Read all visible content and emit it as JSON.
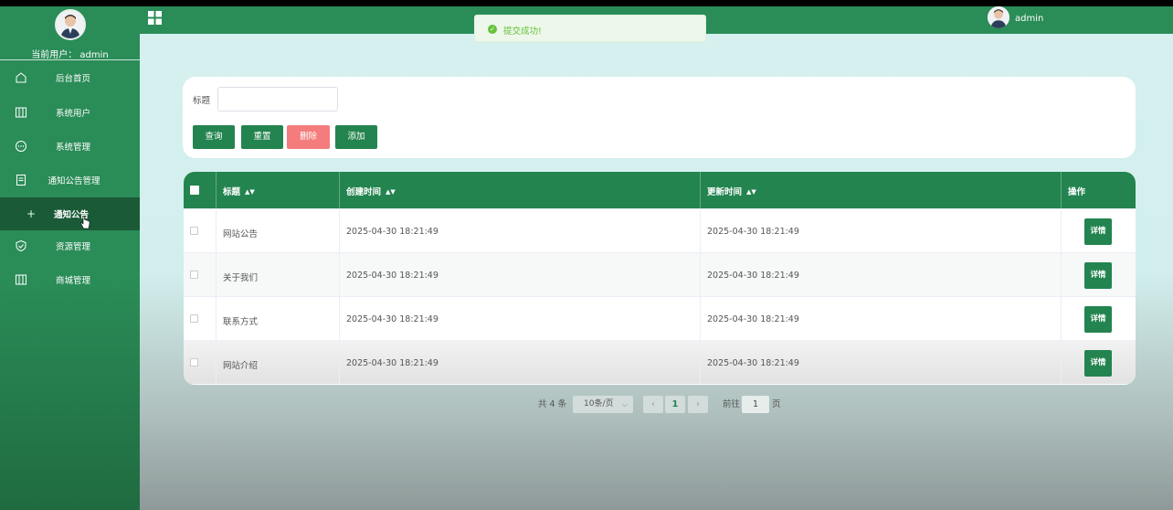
{
  "sidebar": {
    "current_user": "当前用户： admin",
    "items": [
      {
        "label": "后台首页",
        "icon": "home-icon"
      },
      {
        "label": "系统用户",
        "icon": "columns-icon"
      },
      {
        "label": "系统管理",
        "icon": "chat-icon"
      },
      {
        "label": "通知公告管理",
        "icon": "document-icon"
      },
      {
        "label": "通知公告",
        "icon": "plus-icon",
        "active": true
      },
      {
        "label": "资源管理",
        "icon": "shield-icon"
      },
      {
        "label": "商城管理",
        "icon": "columns-icon"
      }
    ]
  },
  "topbar": {
    "title": "",
    "username": "admin"
  },
  "toast": {
    "message": "提交成功!"
  },
  "search": {
    "label": "标题",
    "value": "",
    "buttons": {
      "query": "查询",
      "reset": "重置",
      "delete": "删除",
      "add": "添加"
    }
  },
  "table": {
    "headers": {
      "title": "标题",
      "created": "创建时间",
      "updated": "更新时间",
      "actions": "操作"
    },
    "rows": [
      {
        "title": "网站公告",
        "created": "2025-04-30 18:21:49",
        "updated": "2025-04-30 18:21:49",
        "action": "详情"
      },
      {
        "title": "关于我们",
        "created": "2025-04-30 18:21:49",
        "updated": "2025-04-30 18:21:49",
        "action": "详情"
      },
      {
        "title": "联系方式",
        "created": "2025-04-30 18:21:49",
        "updated": "2025-04-30 18:21:49",
        "action": "详情"
      },
      {
        "title": "网站介绍",
        "created": "2025-04-30 18:21:49",
        "updated": "2025-04-30 18:21:49",
        "action": "详情"
      }
    ]
  },
  "pagination": {
    "total": "共 4 条",
    "page_size": "10条/页",
    "current_page": "1",
    "goto_label": "前往",
    "goto_value": "1",
    "page_suffix": "页"
  },
  "colors": {
    "primary": "#23844f",
    "danger": "#f47c7c",
    "success": "#67c23a"
  }
}
